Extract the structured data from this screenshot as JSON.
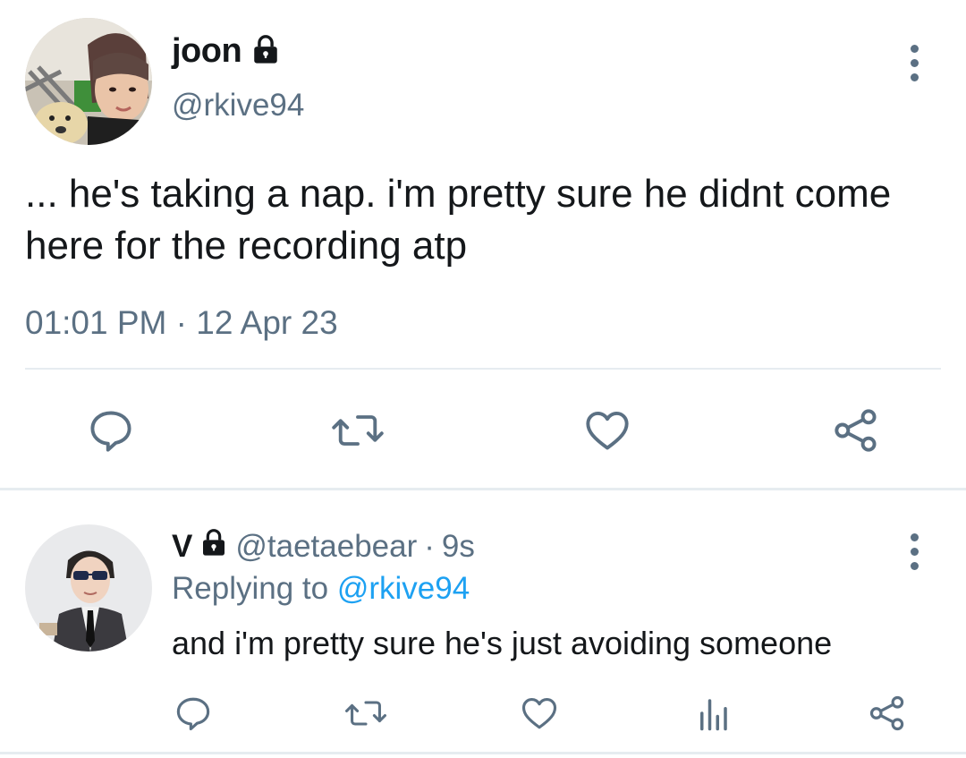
{
  "main_tweet": {
    "display_name": "joon",
    "handle": "@rkive94",
    "text": "... he's taking a nap. i'm pretty sure he didnt come here for the recording atp",
    "timestamp": "01:01 PM · 12 Apr 23",
    "avatar_icon": "user-avatar-photo",
    "actions": [
      "reply-icon",
      "retweet-icon",
      "like-icon",
      "share-icon"
    ]
  },
  "reply_tweet": {
    "display_name": "V",
    "handle": "@taetaebear",
    "separator": "·",
    "time_ago": "9s",
    "replying_prefix": "Replying to",
    "replying_to": "@rkive94",
    "text": "and i'm pretty sure he's just avoiding someone",
    "avatar_icon": "user-avatar-photo",
    "actions": [
      "reply-icon",
      "retweet-icon",
      "like-icon",
      "analytics-icon",
      "share-icon"
    ]
  },
  "colors": {
    "text": "#14171a",
    "muted": "#5b7083",
    "link": "#1da1f2",
    "divider": "#e6ecf0"
  }
}
